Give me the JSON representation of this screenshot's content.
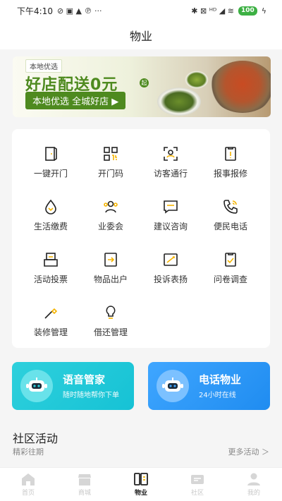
{
  "status_bar": {
    "time": "下午4:10",
    "left_glyphs": "⊘ ▣ ▲ ℗ ···",
    "right_glyphs": "✱ ⊠ ᴴᴰ ◢ ≋",
    "battery": "100",
    "charge": "ϟ"
  },
  "header": {
    "title": "物业"
  },
  "banner": {
    "tag": "本地优选",
    "title": "好店配送0元",
    "title_sup": "起",
    "subtitle": "本地优选 全城好店 ▶"
  },
  "grid": [
    {
      "label": "一键开门",
      "icon": "door-icon"
    },
    {
      "label": "开门码",
      "icon": "qr-code-icon"
    },
    {
      "label": "访客通行",
      "icon": "visitor-scan-icon"
    },
    {
      "label": "报事报修",
      "icon": "repair-report-icon"
    },
    {
      "label": "生活缴费",
      "icon": "water-drop-icon"
    },
    {
      "label": "业委会",
      "icon": "committee-icon"
    },
    {
      "label": "建议咨询",
      "icon": "suggestion-icon"
    },
    {
      "label": "便民电话",
      "icon": "phone-icon"
    },
    {
      "label": "活动投票",
      "icon": "vote-box-icon"
    },
    {
      "label": "物品出户",
      "icon": "item-exit-icon"
    },
    {
      "label": "投诉表扬",
      "icon": "complaint-icon"
    },
    {
      "label": "问卷调查",
      "icon": "survey-icon"
    },
    {
      "label": "装修管理",
      "icon": "renovation-icon"
    },
    {
      "label": "借还管理",
      "icon": "lightbulb-icon"
    }
  ],
  "services": {
    "voice": {
      "title": "语音管家",
      "subtitle": "随时随地帮你下单",
      "icon": "robot-icon"
    },
    "phone": {
      "title": "电话物业",
      "subtitle": "24小时在线",
      "icon": "robot-icon"
    }
  },
  "community": {
    "title": "社区活动",
    "subtitle": "精彩往期",
    "more": "更多活动 ＞"
  },
  "tabs": [
    {
      "label": "首页",
      "icon": "home-icon",
      "active": false
    },
    {
      "label": "商城",
      "icon": "shop-icon",
      "active": false
    },
    {
      "label": "物业",
      "icon": "property-icon",
      "active": true
    },
    {
      "label": "社区",
      "icon": "community-icon",
      "active": false
    },
    {
      "label": "我的",
      "icon": "profile-icon",
      "active": false
    }
  ],
  "colors": {
    "accent": "#f5b400",
    "tab_inactive": "#c8c8c8",
    "voice_card": "#16c2d5",
    "phone_card": "#1f8cf0"
  }
}
